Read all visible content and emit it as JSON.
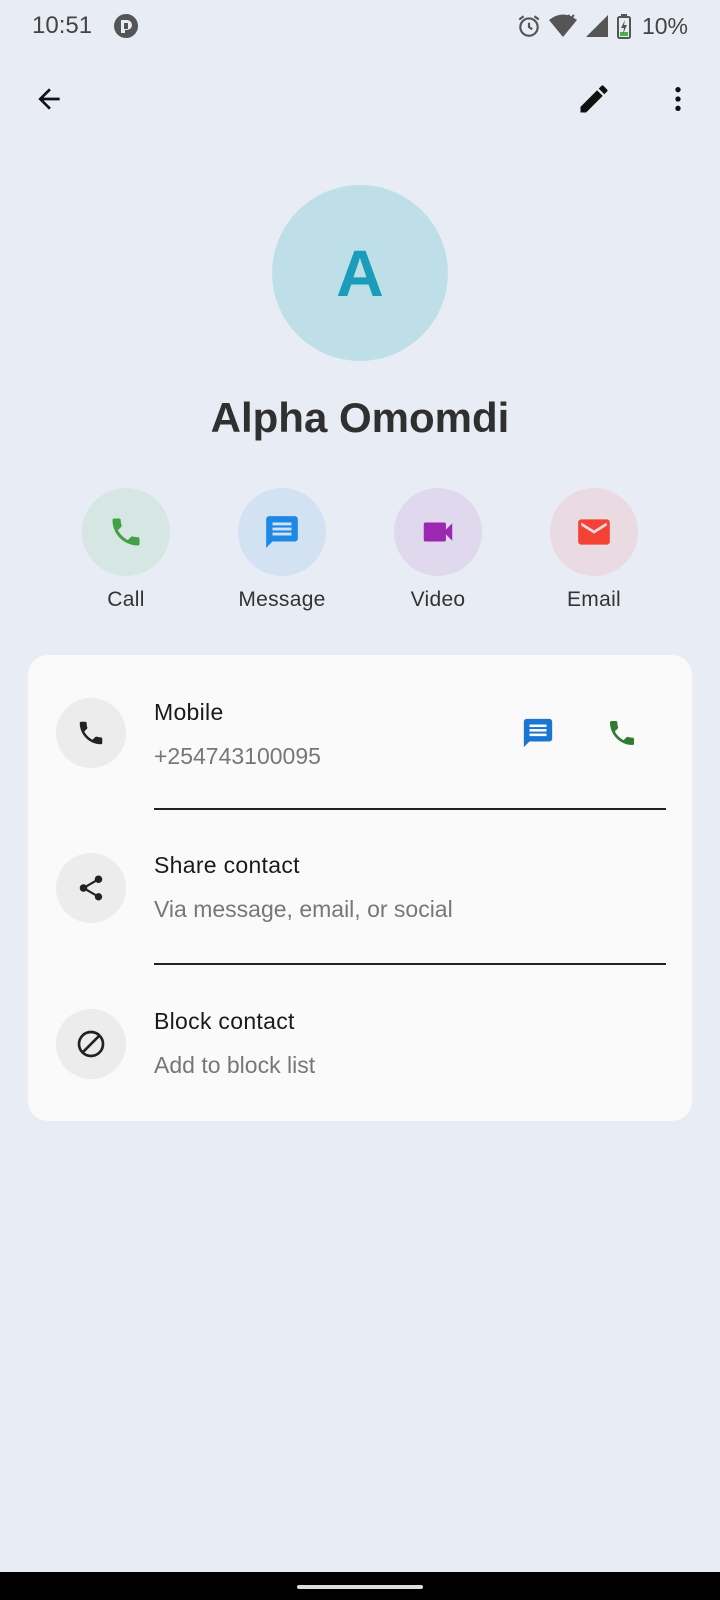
{
  "status_bar": {
    "time": "10:51",
    "battery": "10%",
    "icons": [
      "app-notification-icon",
      "alarm-icon",
      "wifi-icon",
      "signal-icon",
      "battery-charging-icon"
    ]
  },
  "top_bar": {
    "icons": [
      "back-arrow-icon",
      "edit-pencil-icon",
      "more-vert-icon"
    ]
  },
  "contact": {
    "initial": "A",
    "name": "Alpha Omomdi",
    "avatar_bg": "#bfdfe8",
    "avatar_fg": "#1a9dbb"
  },
  "actions": [
    {
      "label": "Call",
      "icon": "phone-icon",
      "color": "#43a047",
      "bg": "#d6e6e2"
    },
    {
      "label": "Message",
      "icon": "message-icon",
      "color": "#1e88e5",
      "bg": "#d3e2f3"
    },
    {
      "label": "Video",
      "icon": "videocam-icon",
      "color": "#9c27b0",
      "bg": "#e0d8ec"
    },
    {
      "label": "Email",
      "icon": "email-icon",
      "color": "#f44336",
      "bg": "#eadbe2"
    }
  ],
  "details": {
    "mobile": {
      "title": "Mobile",
      "value": "+254743100095",
      "icons": [
        "phone-icon",
        "message-icon",
        "call-icon"
      ]
    },
    "share": {
      "title": "Share contact",
      "subtitle": "Via message, email, or social",
      "icon": "share-icon"
    },
    "block": {
      "title": "Block contact",
      "subtitle": "Add to block list",
      "icon": "block-icon"
    }
  }
}
